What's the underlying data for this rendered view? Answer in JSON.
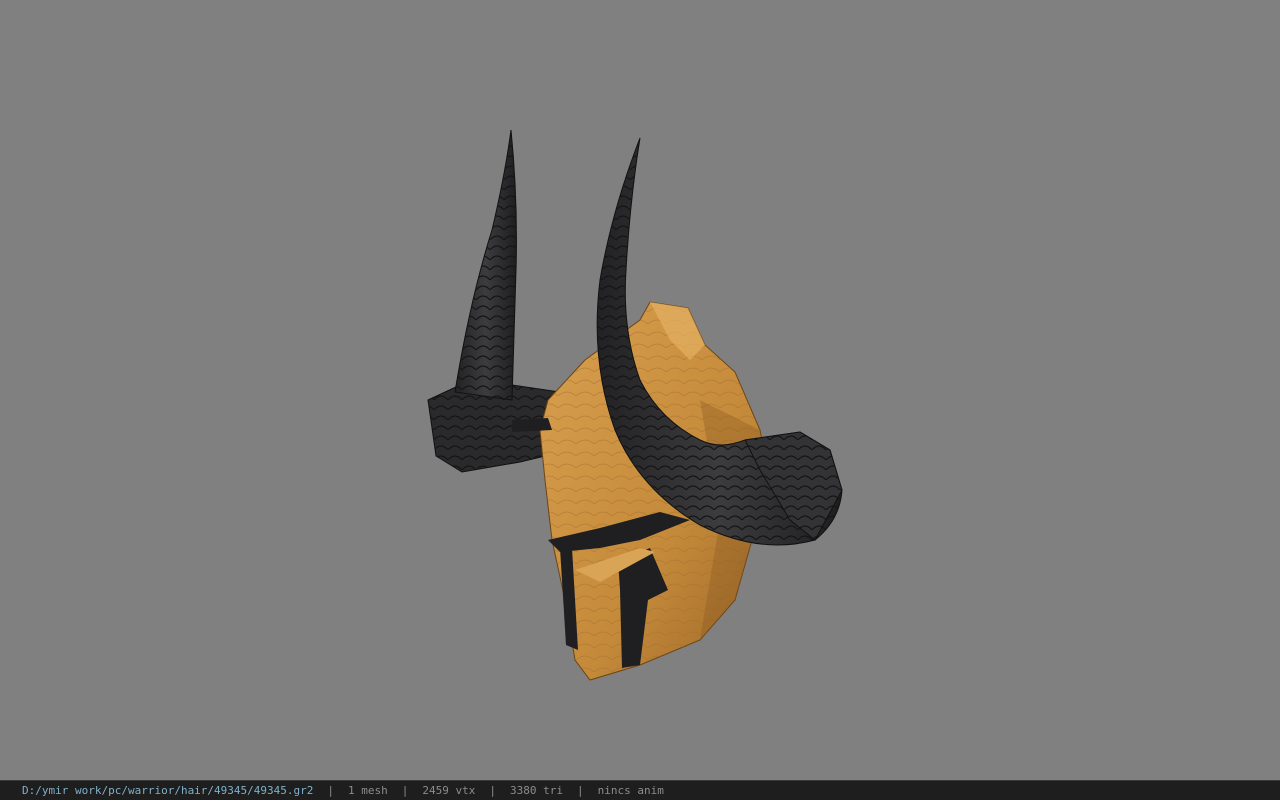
{
  "viewer": {
    "background_color": "#808080",
    "model_name": "helmet-with-horns",
    "model_colors": {
      "armor": "#c8913f",
      "armor_shadow": "#8a5a22",
      "armor_highlight": "#e0a95c",
      "horn": "#2e2e30",
      "horn_shadow": "#1a1a1b",
      "horn_highlight": "#4a4a4d"
    }
  },
  "status": {
    "file_path": "D:/ymir work/pc/warrior/hair/49345/49345.gr2",
    "separator": "|",
    "mesh_count": "1 mesh",
    "vertex_count": "2459 vtx",
    "triangle_count": "3380 tri",
    "anim_state": "nincs anim"
  }
}
